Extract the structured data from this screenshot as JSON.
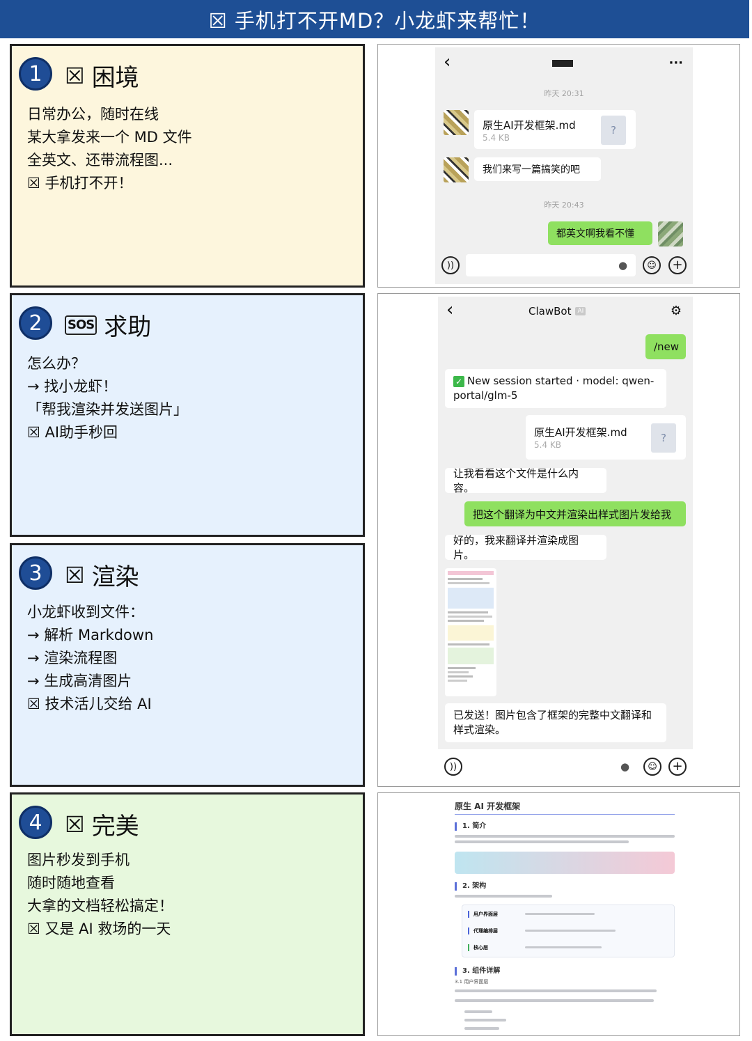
{
  "title": "☒ 手机打不开MD？小龙虾来帮忙！",
  "cards": [
    {
      "num": "1",
      "icon": "☒",
      "heading": "困境",
      "lines": [
        "日常办公，随时在线",
        "某大拿发来一个 MD 文件",
        "全英文、还带流程图...",
        "☒ 手机打不开！"
      ]
    },
    {
      "num": "2",
      "icon": "SOS",
      "heading": "求助",
      "lines": [
        "怎么办？",
        "→ 找小龙虾！",
        "「帮我渲染并发送图片」",
        "☒ AI助手秒回"
      ]
    },
    {
      "num": "3",
      "icon": "☒",
      "heading": "渲染",
      "lines": [
        "小龙虾收到文件：",
        "→ 解析 Markdown",
        "→ 渲染流程图",
        "→ 生成高清图片",
        "☒ 技术活儿交给 AI"
      ]
    },
    {
      "num": "4",
      "icon": "☒",
      "heading": "完美",
      "lines": [
        "图片秒发到手机",
        "随时随地查看",
        "大拿的文档轻松搞定！",
        "☒ 又是 AI 救场的一天"
      ]
    }
  ],
  "chat1": {
    "back": "‹",
    "more": "···",
    "time1": "昨天 20:31",
    "file_name": "原生AI开发框架.md",
    "file_size": "5.4 KB",
    "file_icon": "?",
    "msg1": "我们来写一篇搞笑的吧",
    "time2": "昨天 20:43",
    "reply": "都英文啊我看不懂"
  },
  "chat2": {
    "back": "‹",
    "name": "ClawBot",
    "ai_badge": "AI",
    "cmd": "/new",
    "session_check": "✓",
    "session": "New session started · model: qwen-portal/glm-5",
    "file_name": "原生AI开发框架.md",
    "file_size": "5.4 KB",
    "file_icon": "?",
    "bot1": "让我看看这个文件是什么内容。",
    "user1": "把这个翻译为中文并渲染出样式图片发给我",
    "bot2": "好的，我来翻译并渲染成图片。",
    "bot3": "已发送！图片包含了框架的完整中文翻译和样式渲染。"
  },
  "doc": {
    "title": "原生 AI 开发框架",
    "s1": "1. 简介",
    "s2": "2. 架构",
    "s3": "3. 组件详解",
    "rows": [
      "用户界面层",
      "代理编排层",
      "核心层"
    ],
    "sub": "3.1 用户界面层"
  },
  "colors": {
    "banner": "#1e4f95",
    "card1": "#fdf6dd",
    "card2": "#e6f1fd",
    "card3": "#e6f1fd",
    "card4": "#e7f8dd",
    "green_bubble": "#8fe060",
    "accent": "#1f4d96"
  }
}
